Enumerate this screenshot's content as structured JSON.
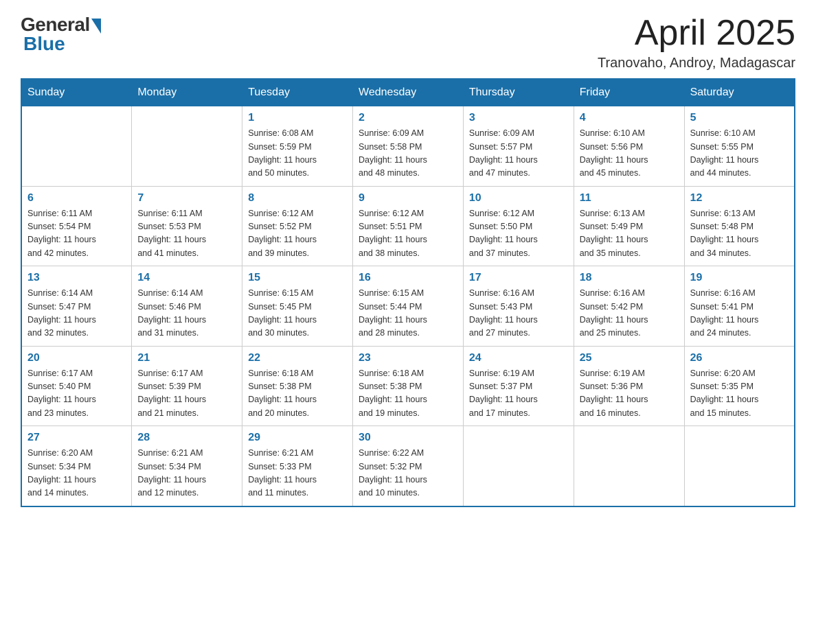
{
  "header": {
    "logo_general": "General",
    "logo_blue": "Blue",
    "title": "April 2025",
    "location": "Tranovaho, Androy, Madagascar"
  },
  "weekdays": [
    "Sunday",
    "Monday",
    "Tuesday",
    "Wednesday",
    "Thursday",
    "Friday",
    "Saturday"
  ],
  "weeks": [
    [
      {
        "day": "",
        "info": ""
      },
      {
        "day": "",
        "info": ""
      },
      {
        "day": "1",
        "info": "Sunrise: 6:08 AM\nSunset: 5:59 PM\nDaylight: 11 hours\nand 50 minutes."
      },
      {
        "day": "2",
        "info": "Sunrise: 6:09 AM\nSunset: 5:58 PM\nDaylight: 11 hours\nand 48 minutes."
      },
      {
        "day": "3",
        "info": "Sunrise: 6:09 AM\nSunset: 5:57 PM\nDaylight: 11 hours\nand 47 minutes."
      },
      {
        "day": "4",
        "info": "Sunrise: 6:10 AM\nSunset: 5:56 PM\nDaylight: 11 hours\nand 45 minutes."
      },
      {
        "day": "5",
        "info": "Sunrise: 6:10 AM\nSunset: 5:55 PM\nDaylight: 11 hours\nand 44 minutes."
      }
    ],
    [
      {
        "day": "6",
        "info": "Sunrise: 6:11 AM\nSunset: 5:54 PM\nDaylight: 11 hours\nand 42 minutes."
      },
      {
        "day": "7",
        "info": "Sunrise: 6:11 AM\nSunset: 5:53 PM\nDaylight: 11 hours\nand 41 minutes."
      },
      {
        "day": "8",
        "info": "Sunrise: 6:12 AM\nSunset: 5:52 PM\nDaylight: 11 hours\nand 39 minutes."
      },
      {
        "day": "9",
        "info": "Sunrise: 6:12 AM\nSunset: 5:51 PM\nDaylight: 11 hours\nand 38 minutes."
      },
      {
        "day": "10",
        "info": "Sunrise: 6:12 AM\nSunset: 5:50 PM\nDaylight: 11 hours\nand 37 minutes."
      },
      {
        "day": "11",
        "info": "Sunrise: 6:13 AM\nSunset: 5:49 PM\nDaylight: 11 hours\nand 35 minutes."
      },
      {
        "day": "12",
        "info": "Sunrise: 6:13 AM\nSunset: 5:48 PM\nDaylight: 11 hours\nand 34 minutes."
      }
    ],
    [
      {
        "day": "13",
        "info": "Sunrise: 6:14 AM\nSunset: 5:47 PM\nDaylight: 11 hours\nand 32 minutes."
      },
      {
        "day": "14",
        "info": "Sunrise: 6:14 AM\nSunset: 5:46 PM\nDaylight: 11 hours\nand 31 minutes."
      },
      {
        "day": "15",
        "info": "Sunrise: 6:15 AM\nSunset: 5:45 PM\nDaylight: 11 hours\nand 30 minutes."
      },
      {
        "day": "16",
        "info": "Sunrise: 6:15 AM\nSunset: 5:44 PM\nDaylight: 11 hours\nand 28 minutes."
      },
      {
        "day": "17",
        "info": "Sunrise: 6:16 AM\nSunset: 5:43 PM\nDaylight: 11 hours\nand 27 minutes."
      },
      {
        "day": "18",
        "info": "Sunrise: 6:16 AM\nSunset: 5:42 PM\nDaylight: 11 hours\nand 25 minutes."
      },
      {
        "day": "19",
        "info": "Sunrise: 6:16 AM\nSunset: 5:41 PM\nDaylight: 11 hours\nand 24 minutes."
      }
    ],
    [
      {
        "day": "20",
        "info": "Sunrise: 6:17 AM\nSunset: 5:40 PM\nDaylight: 11 hours\nand 23 minutes."
      },
      {
        "day": "21",
        "info": "Sunrise: 6:17 AM\nSunset: 5:39 PM\nDaylight: 11 hours\nand 21 minutes."
      },
      {
        "day": "22",
        "info": "Sunrise: 6:18 AM\nSunset: 5:38 PM\nDaylight: 11 hours\nand 20 minutes."
      },
      {
        "day": "23",
        "info": "Sunrise: 6:18 AM\nSunset: 5:38 PM\nDaylight: 11 hours\nand 19 minutes."
      },
      {
        "day": "24",
        "info": "Sunrise: 6:19 AM\nSunset: 5:37 PM\nDaylight: 11 hours\nand 17 minutes."
      },
      {
        "day": "25",
        "info": "Sunrise: 6:19 AM\nSunset: 5:36 PM\nDaylight: 11 hours\nand 16 minutes."
      },
      {
        "day": "26",
        "info": "Sunrise: 6:20 AM\nSunset: 5:35 PM\nDaylight: 11 hours\nand 15 minutes."
      }
    ],
    [
      {
        "day": "27",
        "info": "Sunrise: 6:20 AM\nSunset: 5:34 PM\nDaylight: 11 hours\nand 14 minutes."
      },
      {
        "day": "28",
        "info": "Sunrise: 6:21 AM\nSunset: 5:34 PM\nDaylight: 11 hours\nand 12 minutes."
      },
      {
        "day": "29",
        "info": "Sunrise: 6:21 AM\nSunset: 5:33 PM\nDaylight: 11 hours\nand 11 minutes."
      },
      {
        "day": "30",
        "info": "Sunrise: 6:22 AM\nSunset: 5:32 PM\nDaylight: 11 hours\nand 10 minutes."
      },
      {
        "day": "",
        "info": ""
      },
      {
        "day": "",
        "info": ""
      },
      {
        "day": "",
        "info": ""
      }
    ]
  ]
}
